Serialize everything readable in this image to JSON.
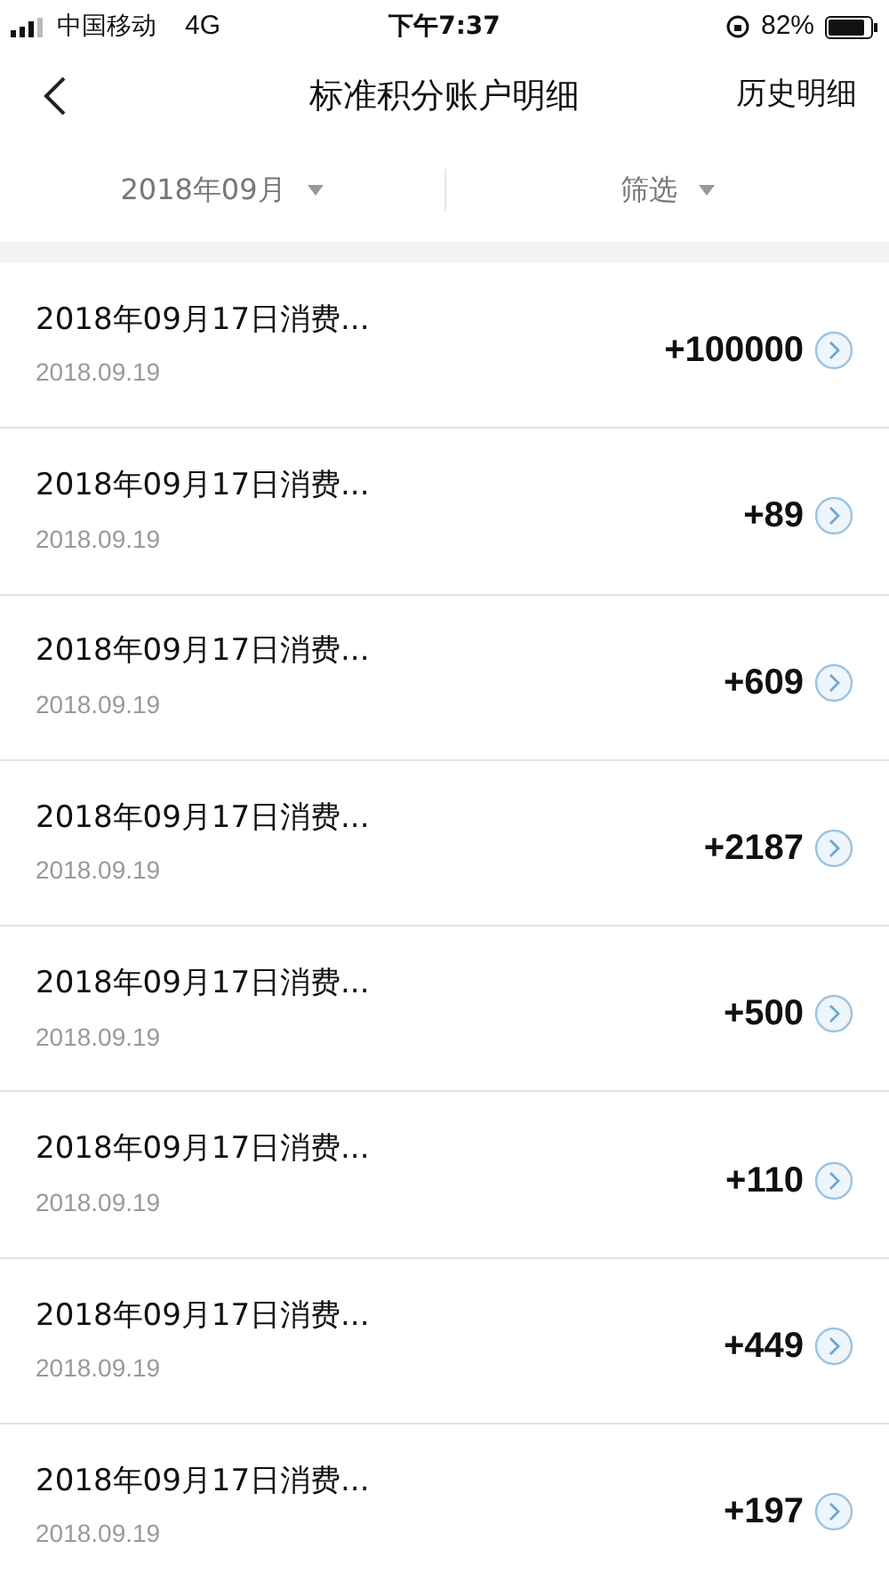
{
  "status_bar": {
    "carrier": "中国移动",
    "network": "4G",
    "time": "下午7:37",
    "battery": "82%"
  },
  "header": {
    "title": "标准积分账户明细",
    "action": "历史明细"
  },
  "filters": [
    {
      "label": "2018年09月"
    },
    {
      "label": "筛选"
    }
  ],
  "records": [
    {
      "title": "2018年09月17日消费...",
      "date": "2018.09.19",
      "amount": "+100000"
    },
    {
      "title": "2018年09月17日消费...",
      "date": "2018.09.19",
      "amount": "+89"
    },
    {
      "title": "2018年09月17日消费...",
      "date": "2018.09.19",
      "amount": "+609"
    },
    {
      "title": "2018年09月17日消费...",
      "date": "2018.09.19",
      "amount": "+2187"
    },
    {
      "title": "2018年09月17日消费...",
      "date": "2018.09.19",
      "amount": "+500"
    },
    {
      "title": "2018年09月17日消费...",
      "date": "2018.09.19",
      "amount": "+110"
    },
    {
      "title": "2018年09月17日消费...",
      "date": "2018.09.19",
      "amount": "+449"
    },
    {
      "title": "2018年09月17日消费...",
      "date": "2018.09.19",
      "amount": "+197"
    }
  ]
}
